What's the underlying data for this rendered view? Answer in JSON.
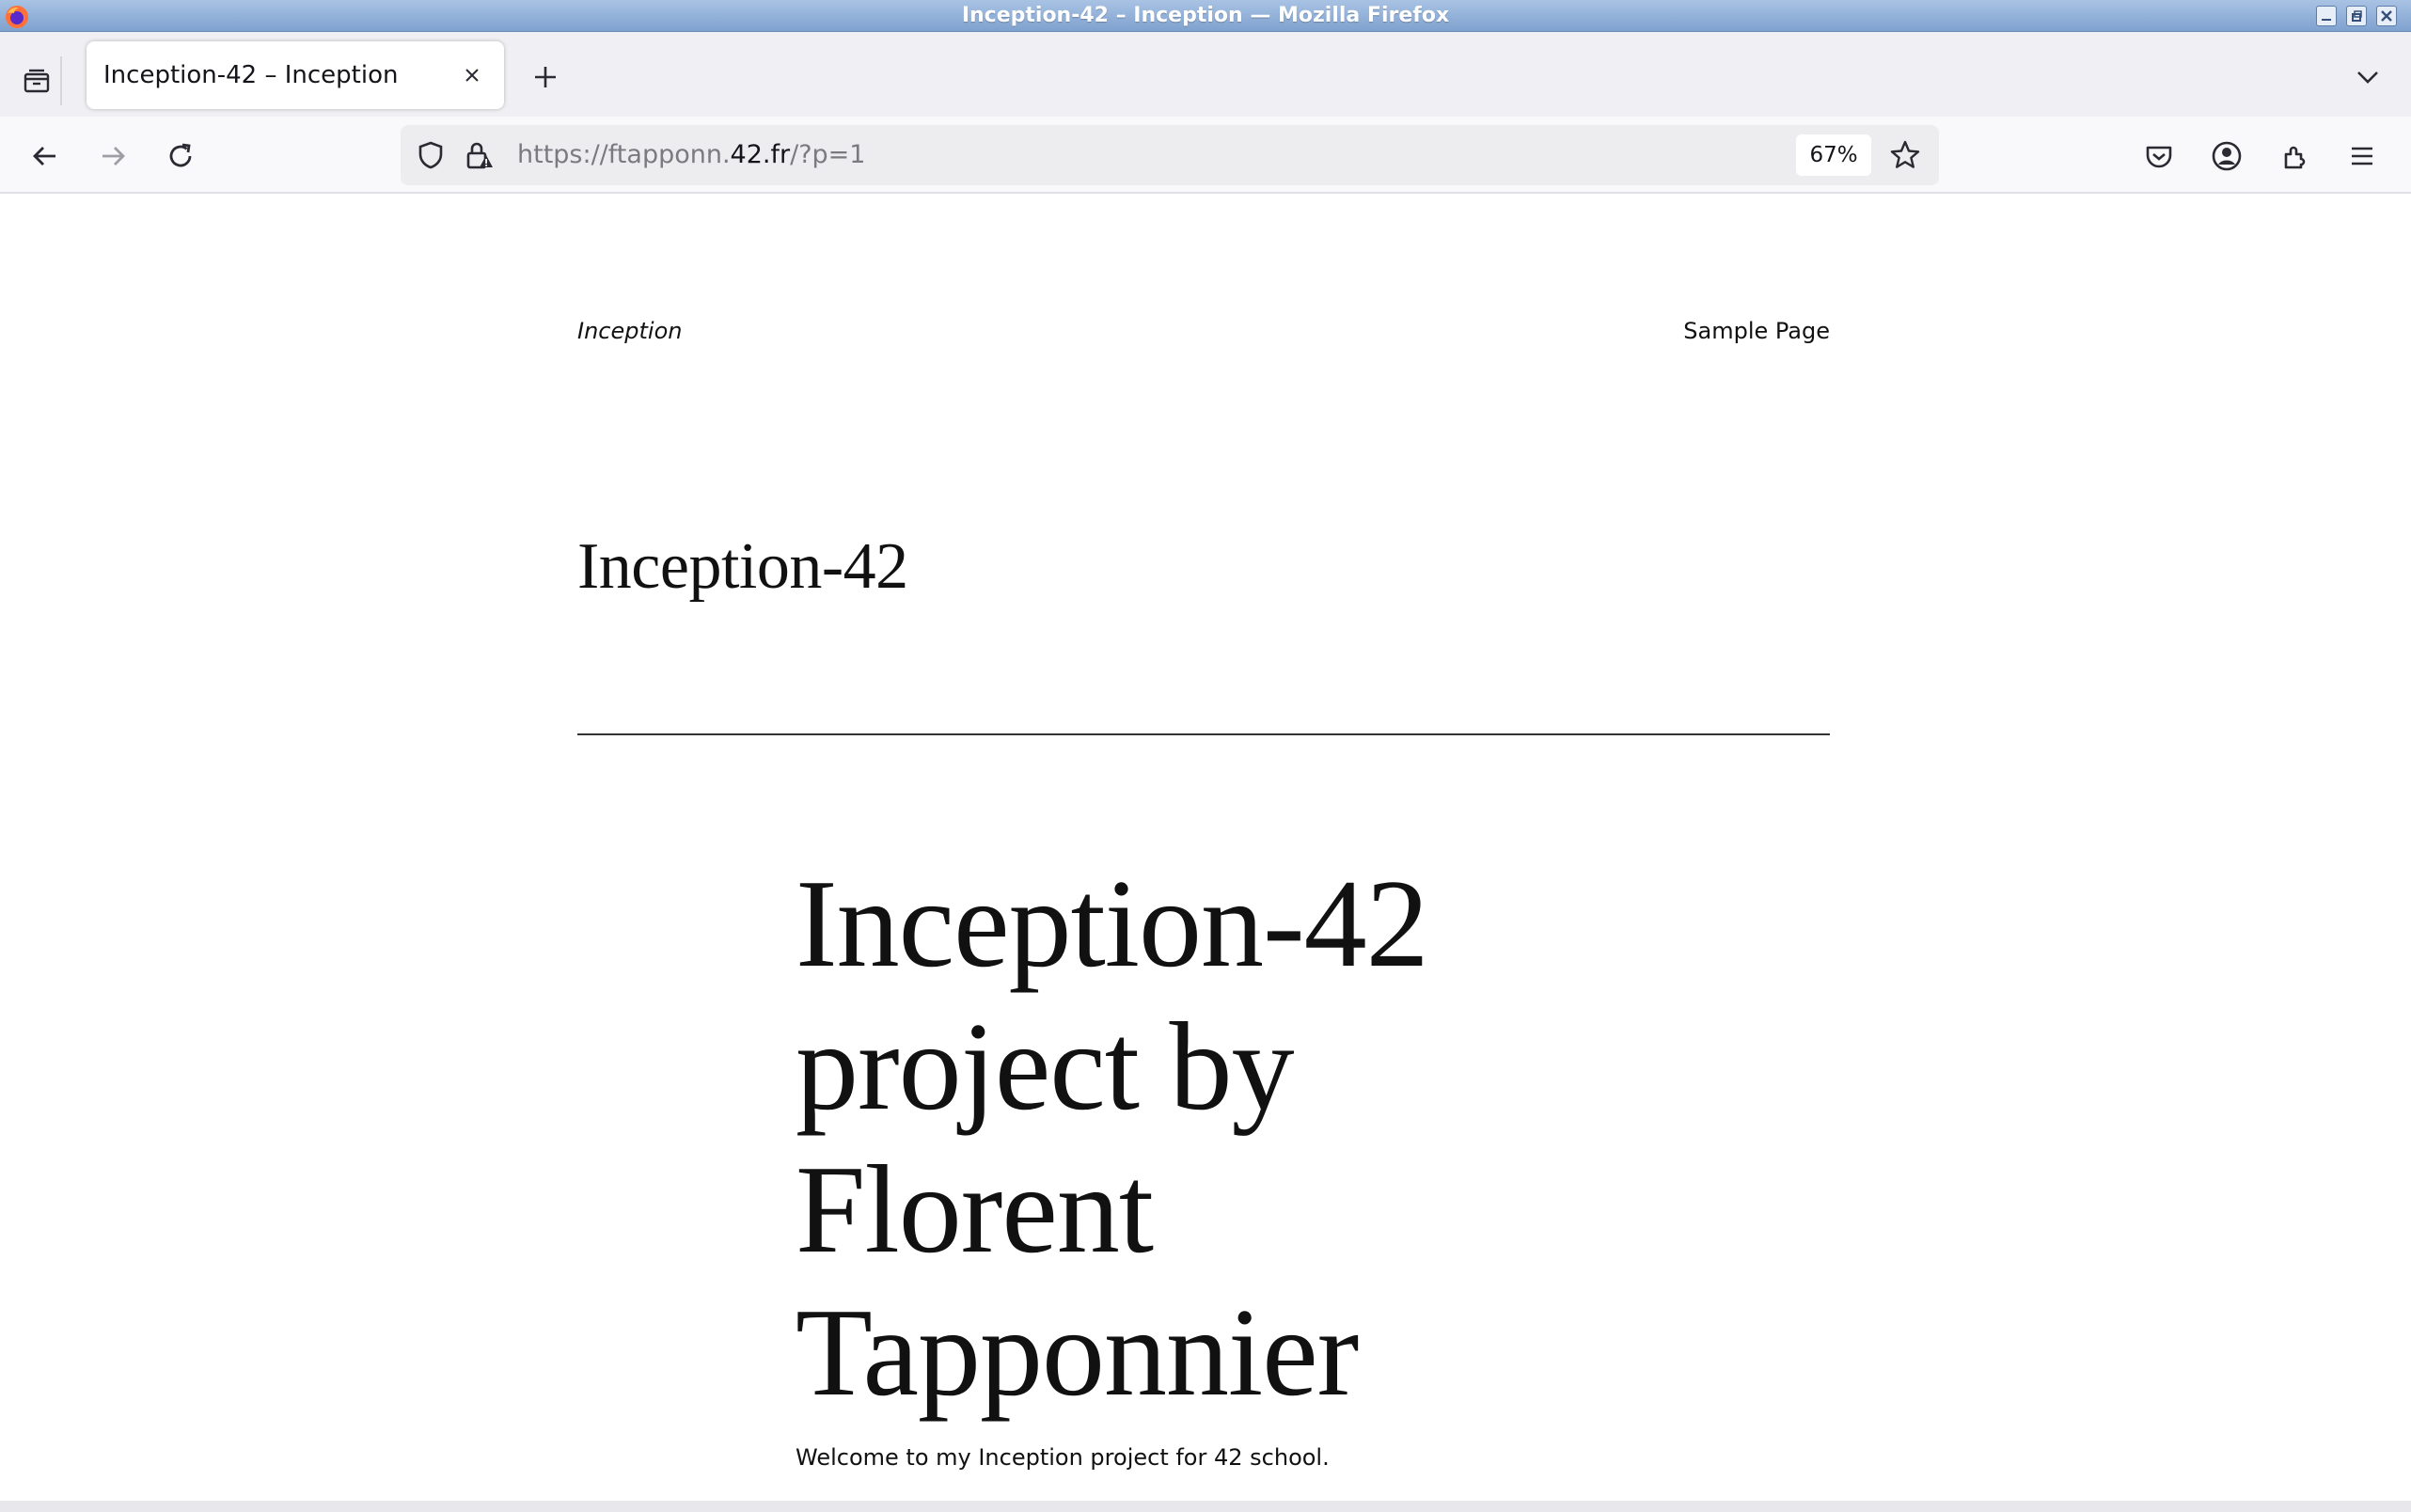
{
  "window": {
    "title": "Inception-42 – Inception — Mozilla Firefox"
  },
  "tabs": [
    {
      "label": "Inception-42 – Inception",
      "active": true
    }
  ],
  "urlbar": {
    "url_prefix": "https://ftapponn.",
    "url_host": "42.fr",
    "url_suffix": "/?p=1",
    "zoom": "67%"
  },
  "page": {
    "site_title": "Inception",
    "nav_link": "Sample Page",
    "blog_title": "Inception-42",
    "post_title": "Inception-42 project by Florent Tapponnier",
    "post_body": "Welcome to my Inception project for 42 school."
  },
  "icons": {
    "app": "firefox-icon",
    "tab_list": "tab-list-icon",
    "tab_close": "close-icon",
    "new_tab": "plus-icon",
    "tab_overflow": "chevron-down-icon",
    "back": "arrow-left-icon",
    "forward": "arrow-right-icon",
    "reload": "reload-icon",
    "shield": "shield-icon",
    "lock": "lock-warning-icon",
    "star": "star-icon",
    "pocket": "pocket-icon",
    "account": "account-icon",
    "extensions": "extensions-icon",
    "menu": "hamburger-menu-icon"
  },
  "colors": {
    "titlebar": "#7fa2cf",
    "tabstrip": "#f0f0f4",
    "toolbar": "#f9f9fb",
    "urlbar": "#ededf0",
    "text": "#111111"
  }
}
